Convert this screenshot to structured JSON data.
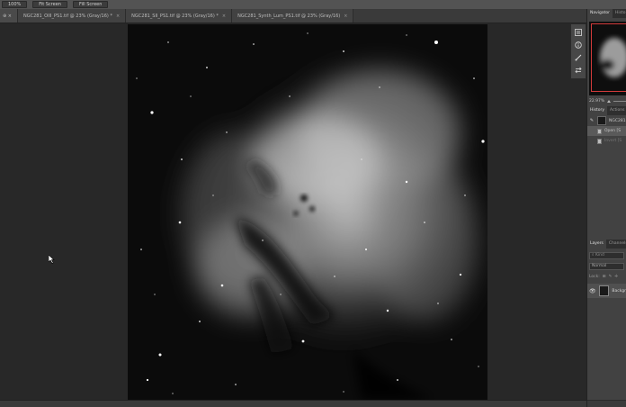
{
  "options_bar": {
    "buttons": [
      "100%",
      "Fit Screen",
      "Fill Screen"
    ]
  },
  "tabs": [
    {
      "label": "⊕ ×",
      "active": true
    },
    {
      "label": "NGC281_OIII_PS1.tif @ 23% (Gray/16) *",
      "close": "×"
    },
    {
      "label": "NGC281_SII_PS1.tif @ 23% (Gray/16) *",
      "close": "×"
    },
    {
      "label": "NGC281_Synth_Lum_PS1.tif @ 23% (Gray/16)",
      "close": "×"
    }
  ],
  "navigator": {
    "tabs": [
      "Navigator",
      "Histo"
    ],
    "zoom": "22.97%",
    "view_box_color": "#d23a3a"
  },
  "history": {
    "tabs": [
      "History",
      "Actions"
    ],
    "snapshot_label": "NGC281",
    "states": [
      "Open [S",
      "Invert [S"
    ]
  },
  "layers": {
    "tabs": [
      "Layers",
      "Channels"
    ],
    "search_placeholder": "Kind",
    "blend_mode": "Normal",
    "lock_label": "Lock:",
    "layer_name": "Backgr"
  },
  "colors": {
    "app_bg": "#282828",
    "panel_bg": "#424242",
    "accent": "#d23a3a"
  }
}
